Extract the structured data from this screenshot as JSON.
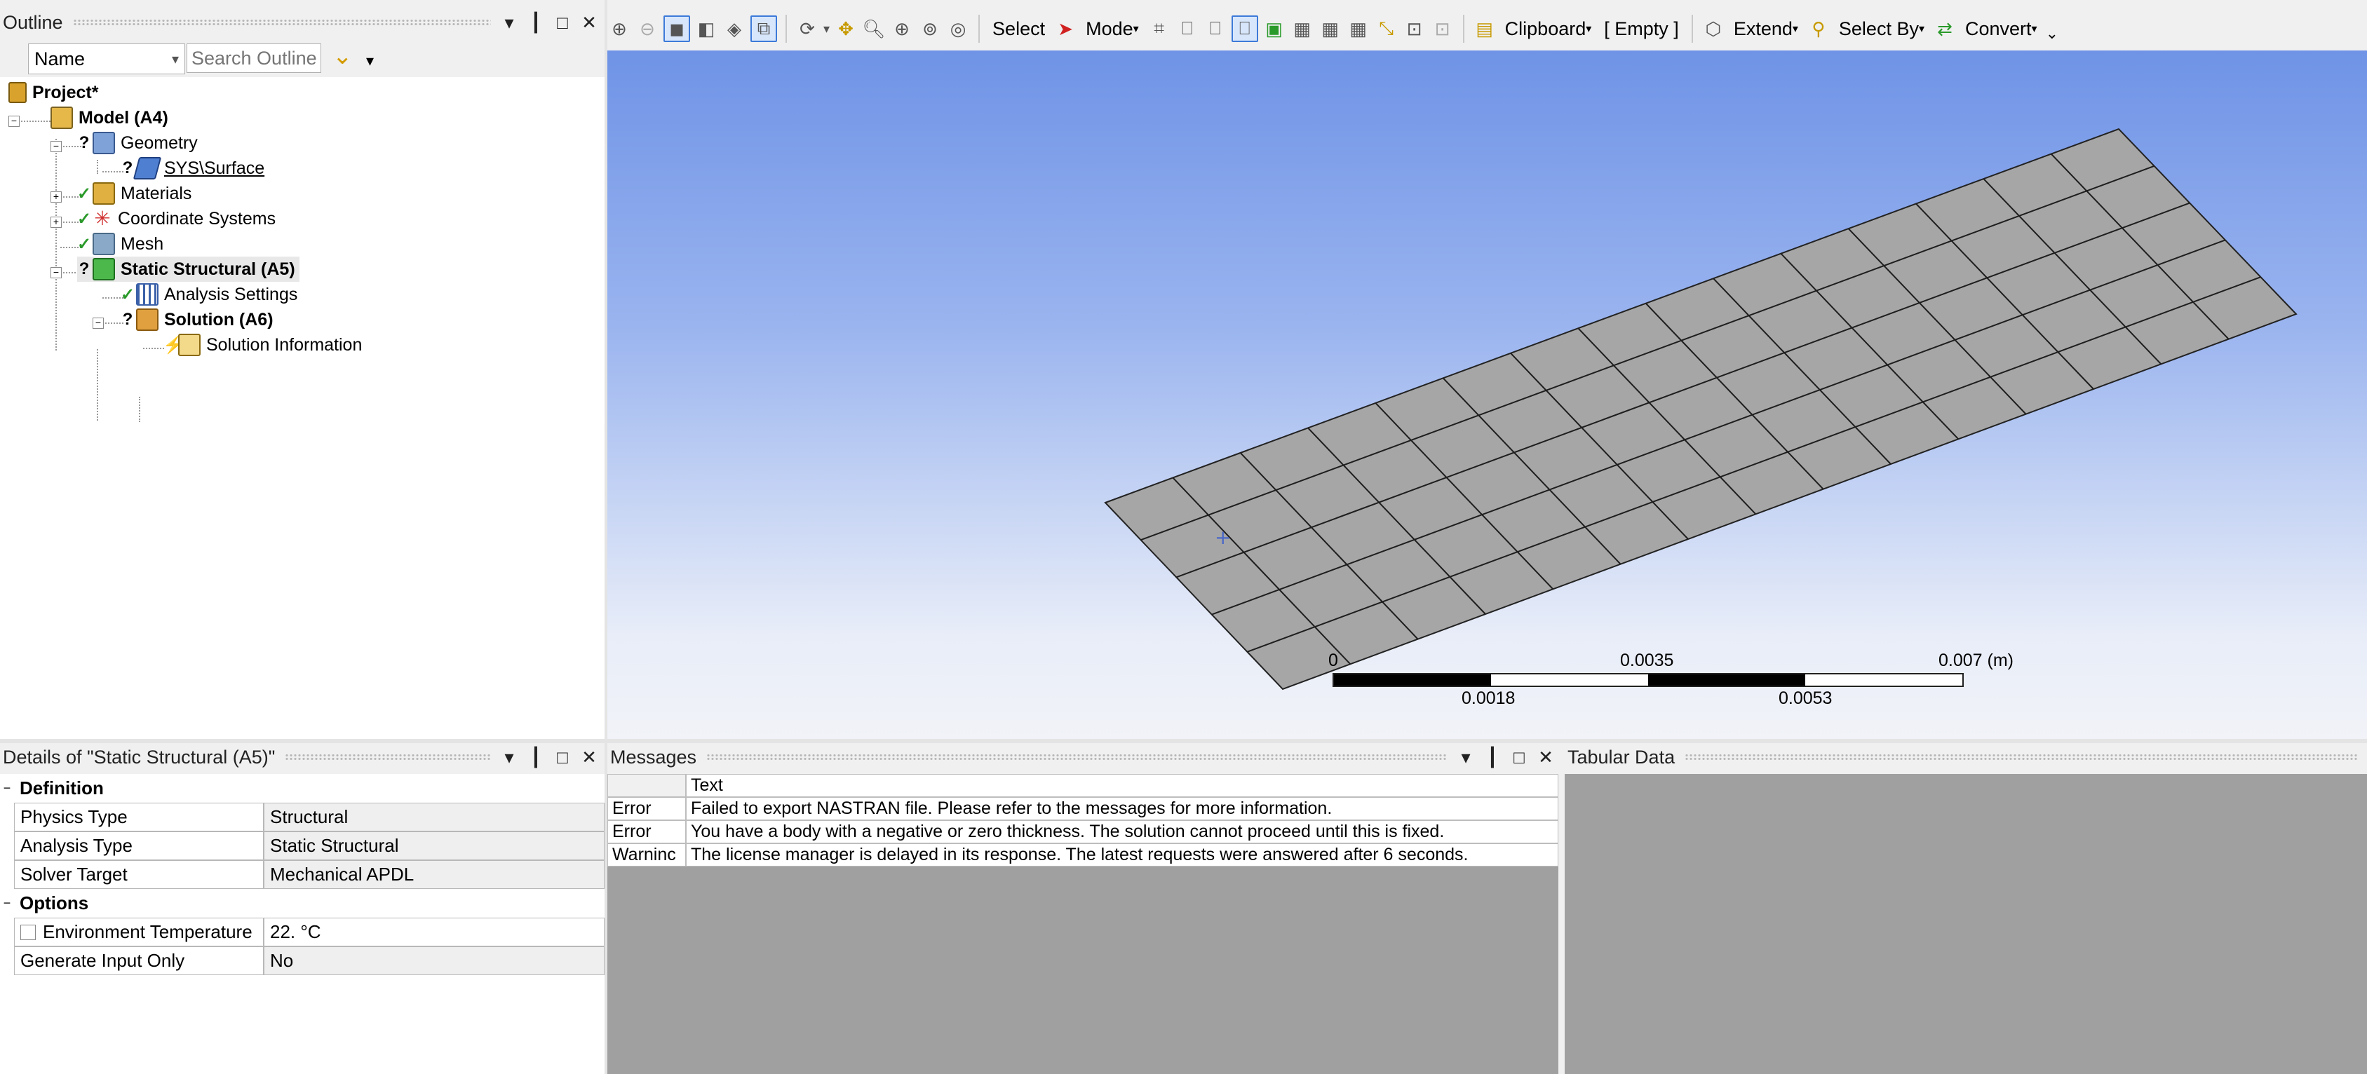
{
  "outline": {
    "title": "Outline",
    "filter_select": "Name",
    "search_placeholder": "Search Outline",
    "tree": [
      {
        "label": "Project*",
        "status": ""
      },
      {
        "label": "Model (A4)",
        "status": ""
      },
      {
        "label": "Geometry",
        "status": "?"
      },
      {
        "label": "SYS\\Surface",
        "status": "?"
      },
      {
        "label": "Materials",
        "status": "✓"
      },
      {
        "label": "Coordinate Systems",
        "status": "✓"
      },
      {
        "label": "Mesh",
        "status": "✓"
      },
      {
        "label": "Static Structural (A5)",
        "status": "?"
      },
      {
        "label": "Analysis Settings",
        "status": "✓"
      },
      {
        "label": "Solution (A6)",
        "status": "?"
      },
      {
        "label": "Solution Information",
        "status": "⚡"
      }
    ]
  },
  "toolbar": {
    "select_label": "Select",
    "mode_label": "Mode",
    "clipboard_label": "Clipboard",
    "empty_label": "[ Empty ]",
    "extend_label": "Extend",
    "select_by_label": "Select By",
    "convert_label": "Convert"
  },
  "viewport": {
    "scale_ticks_top": [
      "0",
      "0.0035",
      "0.007 (m)"
    ],
    "scale_ticks_bottom": [
      "0.0018",
      "0.0053"
    ]
  },
  "details": {
    "title": "Details of \"Static Structural (A5)\"",
    "sections": [
      {
        "name": "Definition",
        "rows": [
          {
            "label": "Physics Type",
            "value": "Structural"
          },
          {
            "label": "Analysis Type",
            "value": "Static Structural"
          },
          {
            "label": "Solver Target",
            "value": "Mechanical APDL"
          }
        ]
      },
      {
        "name": "Options",
        "rows": [
          {
            "label": "Environment Temperature",
            "value": "22. °C"
          },
          {
            "label": "Generate Input Only",
            "value": "No"
          }
        ]
      }
    ]
  },
  "messages": {
    "title": "Messages",
    "column_text": "Text",
    "rows": [
      {
        "type": "Error",
        "text": "Failed to export NASTRAN file. Please refer to the messages for more information."
      },
      {
        "type": "Error",
        "text": "You have a body with a negative or zero thickness. The solution cannot proceed until this is fixed."
      },
      {
        "type": "Warninc",
        "text": "The license manager is delayed in its response. The latest requests were answered after 6 seconds."
      }
    ]
  },
  "tabular": {
    "title": "Tabular Data"
  },
  "panel_controls": {
    "dropdown": "▾",
    "pin": "🖈",
    "maximize": "□",
    "close": "✕"
  },
  "colors": {
    "accent": "#3d7ad8",
    "mesh_fill": "#a6a6a6",
    "viewport_top": "#6f93e6"
  }
}
